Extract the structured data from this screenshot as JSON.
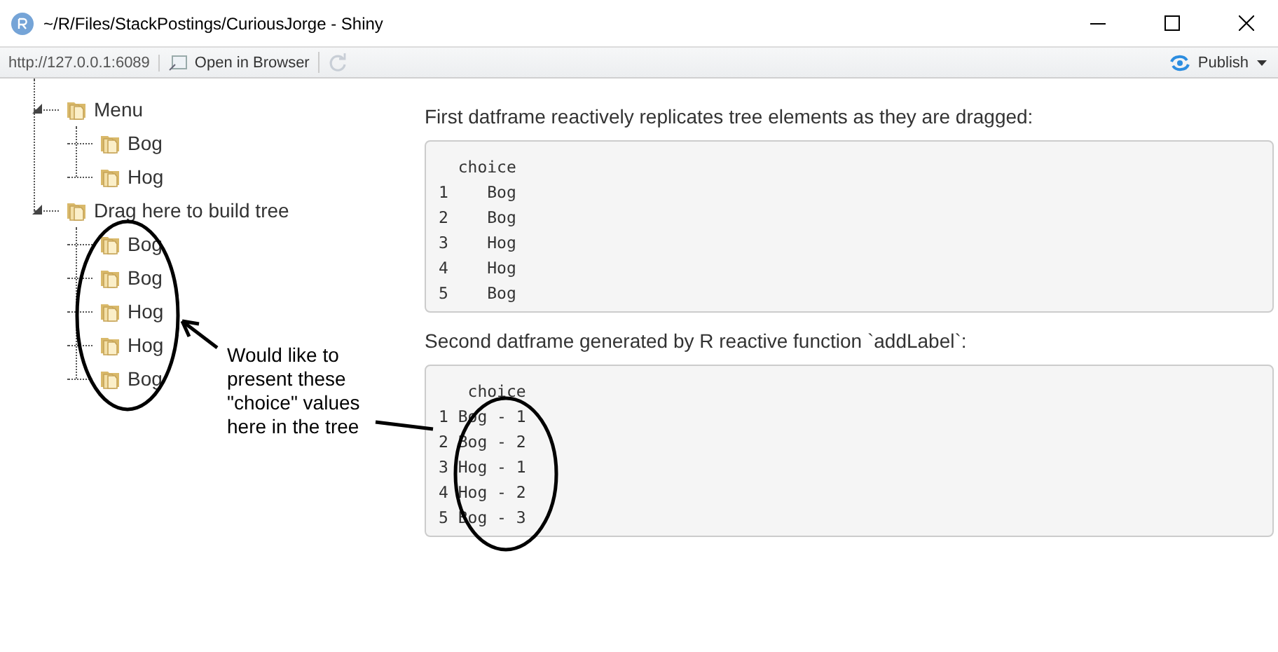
{
  "window": {
    "title": "~/R/Files/StackPostings/CuriousJorge - Shiny"
  },
  "toolbar": {
    "url": "http://127.0.0.1:6089",
    "open_button": "Open in Browser",
    "publish_button": "Publish"
  },
  "tree": [
    {
      "label": "Menu",
      "expanded": true,
      "children": [
        {
          "label": "Bog"
        },
        {
          "label": "Hog"
        }
      ]
    },
    {
      "label": "Drag here to build tree",
      "expanded": true,
      "children": [
        {
          "label": "Bog"
        },
        {
          "label": "Bog"
        },
        {
          "label": "Hog"
        },
        {
          "label": "Hog"
        },
        {
          "label": "Bog"
        }
      ]
    }
  ],
  "outputs": [
    {
      "caption": "First datframe reactively replicates tree elements as they are dragged:",
      "lines": [
        "  choice",
        "1    Bog",
        "2    Bog",
        "3    Hog",
        "4    Hog",
        "5    Bog"
      ]
    },
    {
      "caption": "Second datframe generated by R reactive function `addLabel`:",
      "lines": [
        "   choice",
        "1 Bog - 1",
        "2 Bog - 2",
        "3 Hog - 1",
        "4 Hog - 2",
        "5 Bog - 3"
      ]
    }
  ],
  "annotation": {
    "note": "Would like to present these \"choice\" values here in the tree"
  }
}
